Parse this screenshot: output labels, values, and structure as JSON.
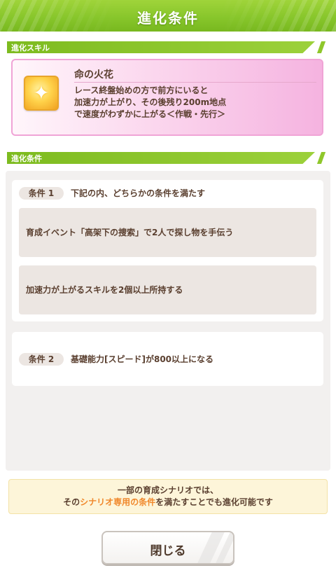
{
  "header": {
    "title": "進化条件"
  },
  "skill_section": {
    "label": "進化スキル"
  },
  "skill": {
    "name": "命の火花",
    "icon": "running-figure-icon",
    "description": [
      "レース終盤始めの方で前方にいると",
      "加速力が上がり、その後残り200m地点",
      "で速度がわずかに上がる＜作戦・先行＞"
    ]
  },
  "conditions_section": {
    "label": "進化条件"
  },
  "conditions": [
    {
      "tag": "条件 1",
      "text": "下記の内、どちらかの条件を満たす",
      "options": [
        "育成イベント「高架下の捜索」で2人で探し物を手伝う",
        "加速力が上がるスキルを2個以上所持する"
      ]
    },
    {
      "tag": "条件 2",
      "text": "基礎能力[スピード]が800以上になる"
    }
  ],
  "note": {
    "line1": "一部の育成シナリオでは、",
    "line2_pre": "その",
    "line2_highlight": "シナリオ専用の条件",
    "line2_post": "を満たすことでも進化可能です"
  },
  "close_button": {
    "label": "閉じる"
  },
  "colors": {
    "header_green": "#86c52a",
    "skill_pink": "#f5b3e0",
    "text_brown": "#5a3f2f",
    "highlight_orange": "#f0872a"
  }
}
